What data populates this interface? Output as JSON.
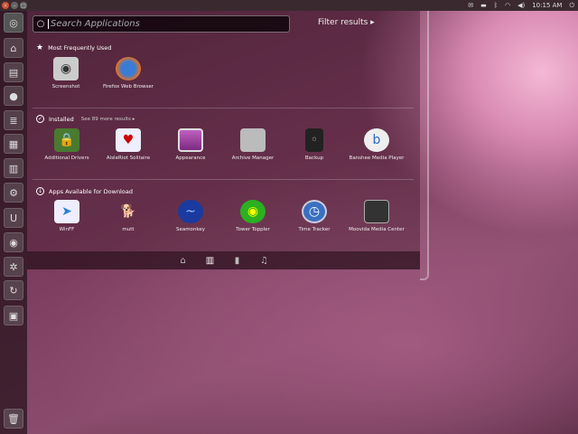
{
  "topbar": {
    "time": "10:15 AM",
    "tray_icons": [
      "mail-icon",
      "battery-icon",
      "bluetooth-icon",
      "wifi-icon",
      "volume-icon",
      "power-icon"
    ]
  },
  "launcher": {
    "items": [
      "ubuntu-logo",
      "home-folder",
      "files",
      "firefox",
      "document",
      "spreadsheet",
      "presentation",
      "settings",
      "ubuntu-one",
      "screenshot",
      "system-settings",
      "update-manager",
      "workspaces",
      "trash"
    ]
  },
  "search": {
    "placeholder": "Search Applications",
    "value": ""
  },
  "filter_label": "Filter results ▸",
  "sections": [
    {
      "title": "Most Frequently Used",
      "icon": "star-icon",
      "apps": [
        "Screenshot",
        "Firefox Web Browser"
      ]
    },
    {
      "title": "Installed",
      "icon": "check-icon",
      "more": "See 89 more results ▸",
      "apps": [
        "Additional Drivers",
        "AisleRiot Solitaire",
        "Appearance",
        "Archive Manager",
        "Backup",
        "Banshee Media Player"
      ]
    },
    {
      "title": "Apps Available for Download",
      "icon": "download-icon",
      "apps": [
        "WinFF",
        "mutt",
        "Seamonkey",
        "Tower Toppler",
        "Time Tracker",
        "Moovida Media Center"
      ]
    }
  ],
  "lenses": [
    "home",
    "applications",
    "files",
    "music"
  ],
  "active_lens": "applications"
}
